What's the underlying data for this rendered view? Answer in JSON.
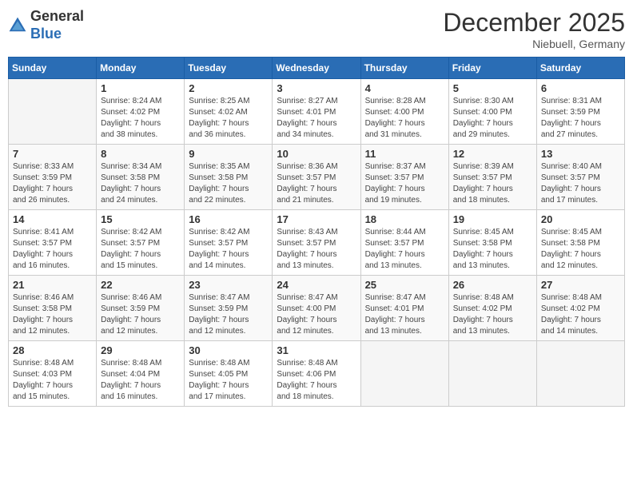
{
  "header": {
    "logo": {
      "line1": "General",
      "line2": "Blue"
    },
    "title": "December 2025",
    "location": "Niebuell, Germany"
  },
  "weekdays": [
    "Sunday",
    "Monday",
    "Tuesday",
    "Wednesday",
    "Thursday",
    "Friday",
    "Saturday"
  ],
  "weeks": [
    [
      {
        "day": "",
        "info": ""
      },
      {
        "day": "1",
        "info": "Sunrise: 8:24 AM\nSunset: 4:02 PM\nDaylight: 7 hours\nand 38 minutes."
      },
      {
        "day": "2",
        "info": "Sunrise: 8:25 AM\nSunset: 4:02 AM\nDaylight: 7 hours\nand 36 minutes."
      },
      {
        "day": "3",
        "info": "Sunrise: 8:27 AM\nSunset: 4:01 PM\nDaylight: 7 hours\nand 34 minutes."
      },
      {
        "day": "4",
        "info": "Sunrise: 8:28 AM\nSunset: 4:00 PM\nDaylight: 7 hours\nand 31 minutes."
      },
      {
        "day": "5",
        "info": "Sunrise: 8:30 AM\nSunset: 4:00 PM\nDaylight: 7 hours\nand 29 minutes."
      },
      {
        "day": "6",
        "info": "Sunrise: 8:31 AM\nSunset: 3:59 PM\nDaylight: 7 hours\nand 27 minutes."
      }
    ],
    [
      {
        "day": "7",
        "info": "Sunrise: 8:33 AM\nSunset: 3:59 PM\nDaylight: 7 hours\nand 26 minutes."
      },
      {
        "day": "8",
        "info": "Sunrise: 8:34 AM\nSunset: 3:58 PM\nDaylight: 7 hours\nand 24 minutes."
      },
      {
        "day": "9",
        "info": "Sunrise: 8:35 AM\nSunset: 3:58 PM\nDaylight: 7 hours\nand 22 minutes."
      },
      {
        "day": "10",
        "info": "Sunrise: 8:36 AM\nSunset: 3:57 PM\nDaylight: 7 hours\nand 21 minutes."
      },
      {
        "day": "11",
        "info": "Sunrise: 8:37 AM\nSunset: 3:57 PM\nDaylight: 7 hours\nand 19 minutes."
      },
      {
        "day": "12",
        "info": "Sunrise: 8:39 AM\nSunset: 3:57 PM\nDaylight: 7 hours\nand 18 minutes."
      },
      {
        "day": "13",
        "info": "Sunrise: 8:40 AM\nSunset: 3:57 PM\nDaylight: 7 hours\nand 17 minutes."
      }
    ],
    [
      {
        "day": "14",
        "info": "Sunrise: 8:41 AM\nSunset: 3:57 PM\nDaylight: 7 hours\nand 16 minutes."
      },
      {
        "day": "15",
        "info": "Sunrise: 8:42 AM\nSunset: 3:57 PM\nDaylight: 7 hours\nand 15 minutes."
      },
      {
        "day": "16",
        "info": "Sunrise: 8:42 AM\nSunset: 3:57 PM\nDaylight: 7 hours\nand 14 minutes."
      },
      {
        "day": "17",
        "info": "Sunrise: 8:43 AM\nSunset: 3:57 PM\nDaylight: 7 hours\nand 13 minutes."
      },
      {
        "day": "18",
        "info": "Sunrise: 8:44 AM\nSunset: 3:57 PM\nDaylight: 7 hours\nand 13 minutes."
      },
      {
        "day": "19",
        "info": "Sunrise: 8:45 AM\nSunset: 3:58 PM\nDaylight: 7 hours\nand 13 minutes."
      },
      {
        "day": "20",
        "info": "Sunrise: 8:45 AM\nSunset: 3:58 PM\nDaylight: 7 hours\nand 12 minutes."
      }
    ],
    [
      {
        "day": "21",
        "info": "Sunrise: 8:46 AM\nSunset: 3:58 PM\nDaylight: 7 hours\nand 12 minutes."
      },
      {
        "day": "22",
        "info": "Sunrise: 8:46 AM\nSunset: 3:59 PM\nDaylight: 7 hours\nand 12 minutes."
      },
      {
        "day": "23",
        "info": "Sunrise: 8:47 AM\nSunset: 3:59 PM\nDaylight: 7 hours\nand 12 minutes."
      },
      {
        "day": "24",
        "info": "Sunrise: 8:47 AM\nSunset: 4:00 PM\nDaylight: 7 hours\nand 12 minutes."
      },
      {
        "day": "25",
        "info": "Sunrise: 8:47 AM\nSunset: 4:01 PM\nDaylight: 7 hours\nand 13 minutes."
      },
      {
        "day": "26",
        "info": "Sunrise: 8:48 AM\nSunset: 4:02 PM\nDaylight: 7 hours\nand 13 minutes."
      },
      {
        "day": "27",
        "info": "Sunrise: 8:48 AM\nSunset: 4:02 PM\nDaylight: 7 hours\nand 14 minutes."
      }
    ],
    [
      {
        "day": "28",
        "info": "Sunrise: 8:48 AM\nSunset: 4:03 PM\nDaylight: 7 hours\nand 15 minutes."
      },
      {
        "day": "29",
        "info": "Sunrise: 8:48 AM\nSunset: 4:04 PM\nDaylight: 7 hours\nand 16 minutes."
      },
      {
        "day": "30",
        "info": "Sunrise: 8:48 AM\nSunset: 4:05 PM\nDaylight: 7 hours\nand 17 minutes."
      },
      {
        "day": "31",
        "info": "Sunrise: 8:48 AM\nSunset: 4:06 PM\nDaylight: 7 hours\nand 18 minutes."
      },
      {
        "day": "",
        "info": ""
      },
      {
        "day": "",
        "info": ""
      },
      {
        "day": "",
        "info": ""
      }
    ]
  ]
}
